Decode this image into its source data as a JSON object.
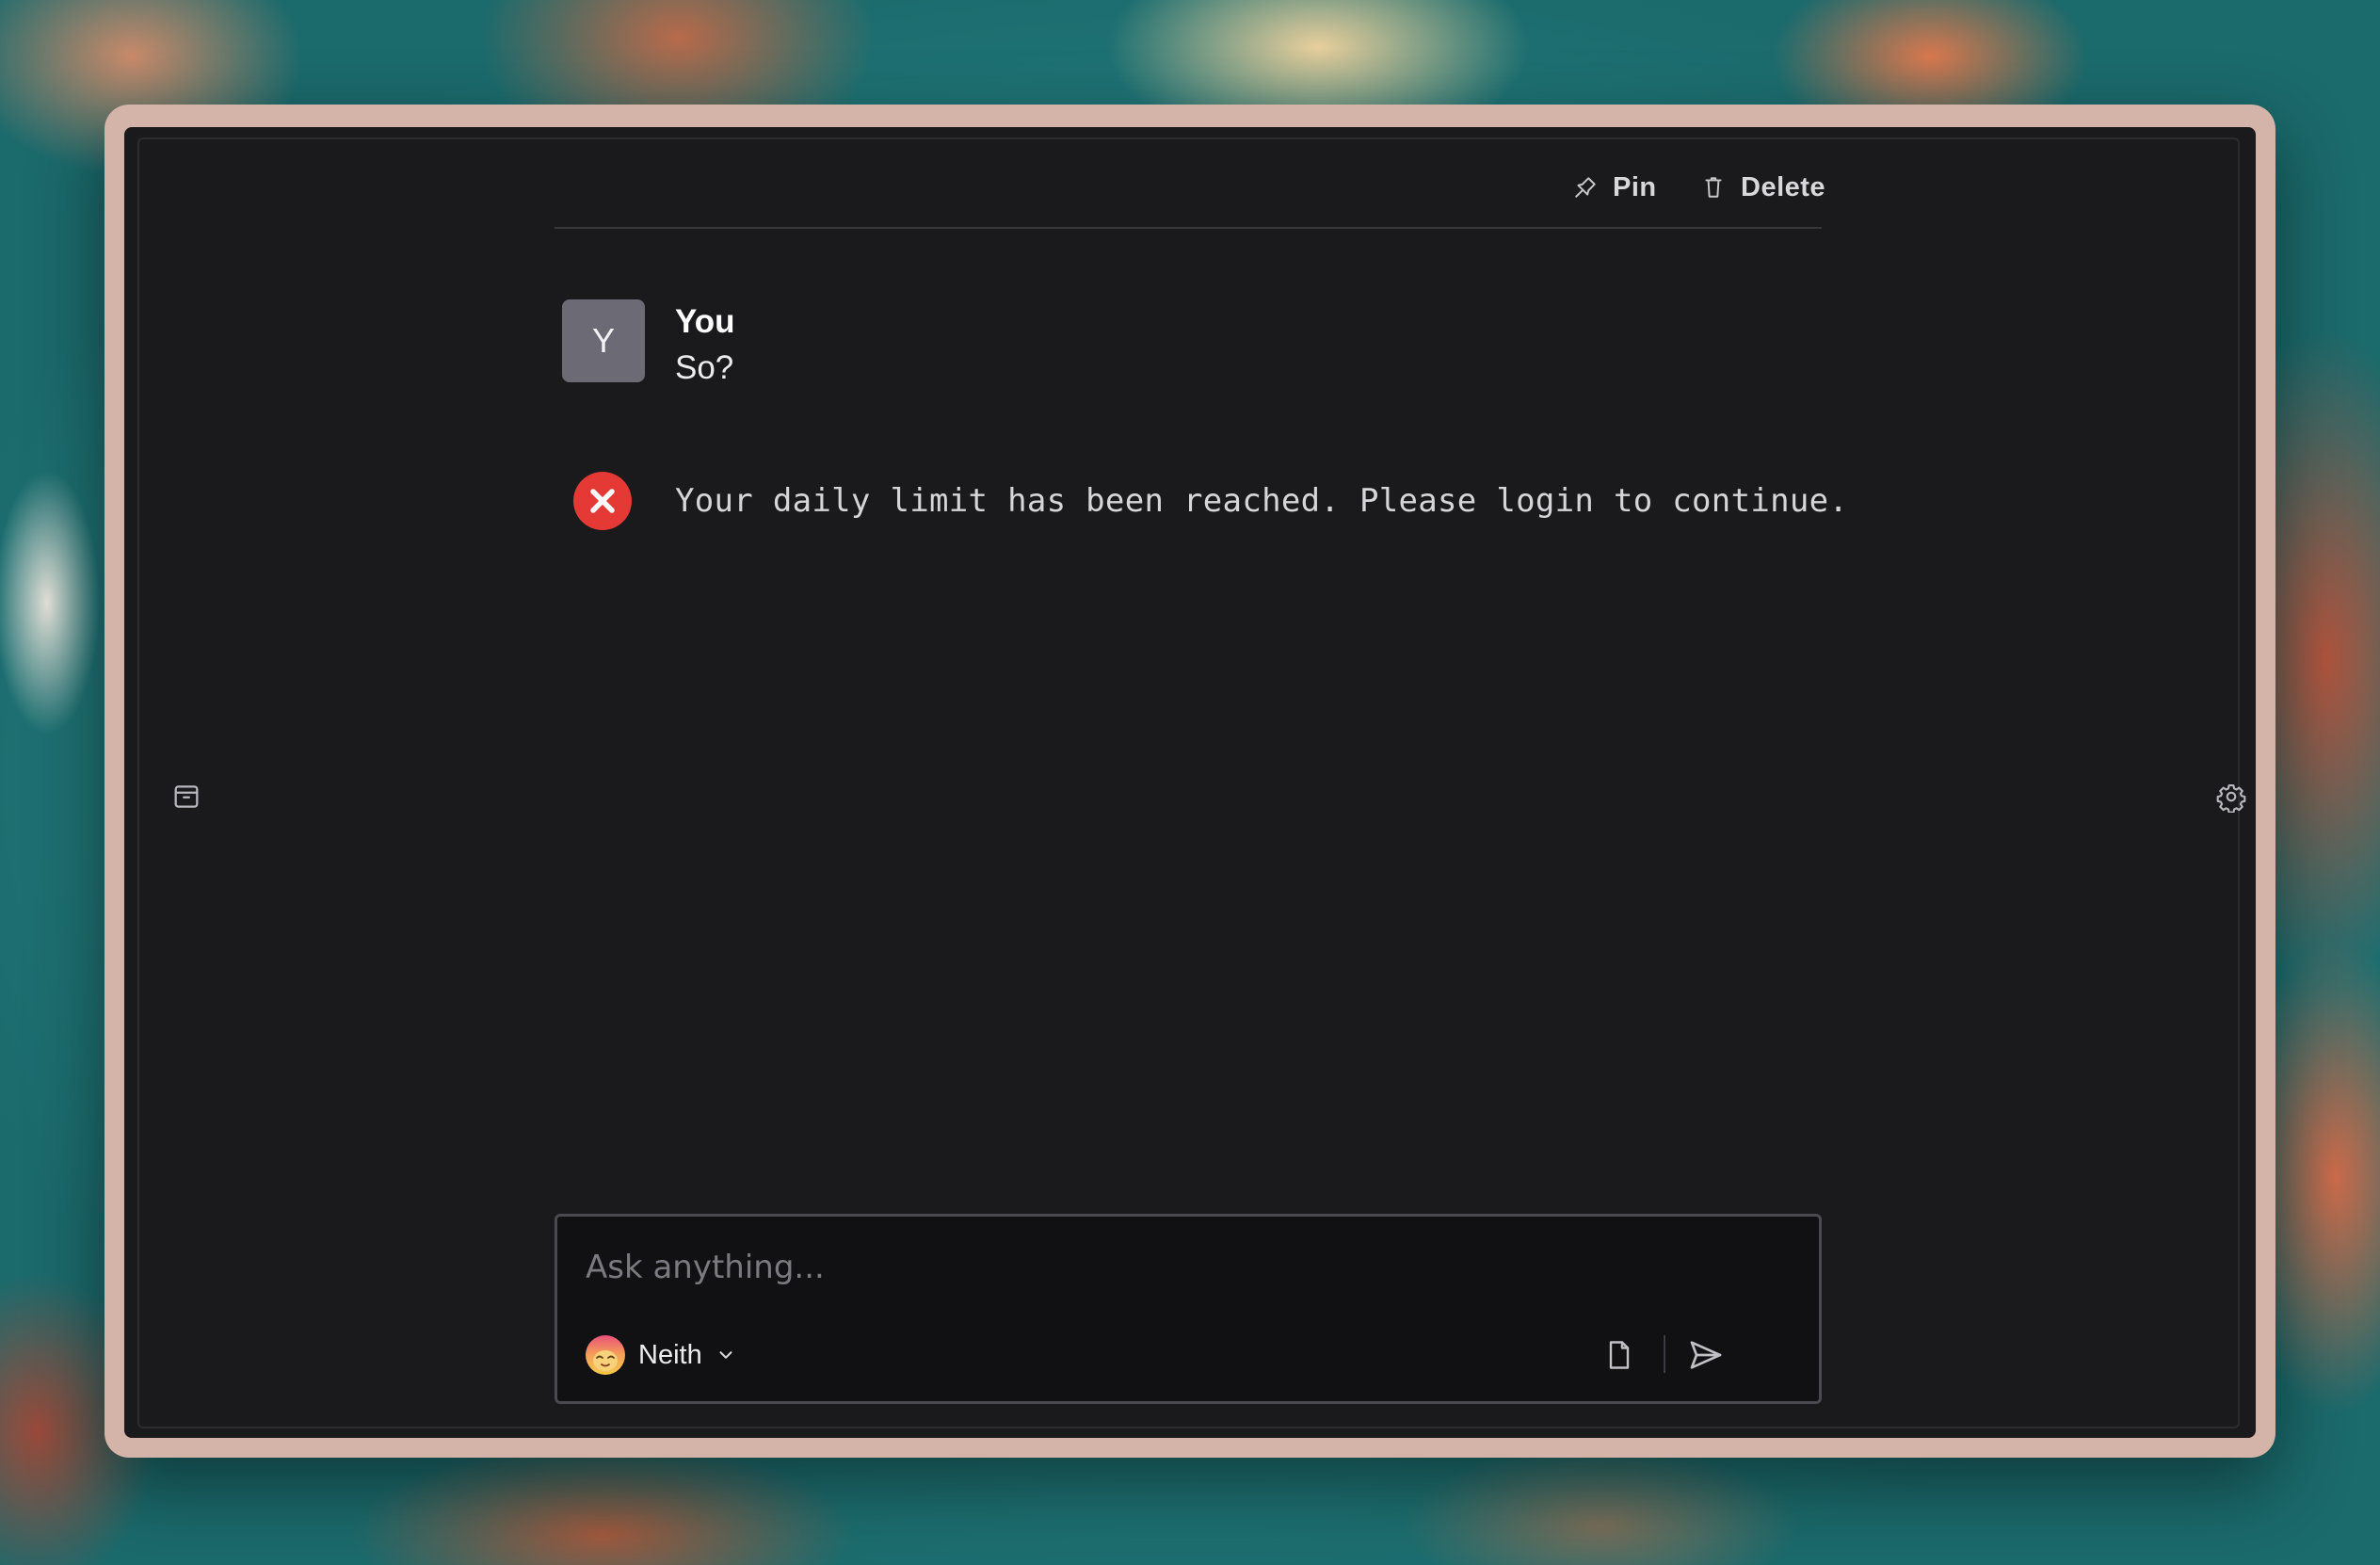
{
  "toolbar": {
    "pin_label": "Pin",
    "delete_label": "Delete"
  },
  "messages": [
    {
      "author": "You",
      "avatar_initial": "Y",
      "text": "So?"
    }
  ],
  "error": {
    "icon": "error-x-icon",
    "text": "Your daily limit has been reached. Please login to continue."
  },
  "composer": {
    "placeholder": "Ask anything...",
    "value": "",
    "model_name": "Neith"
  },
  "icons": {
    "left_sidebar": "archive-icon",
    "right_sidebar": "settings-gear-icon",
    "pin": "pin-icon",
    "delete": "trash-icon",
    "attach": "file-icon",
    "send": "send-icon",
    "model_dropdown": "chevron-down-icon"
  },
  "colors": {
    "window_frame": "#d4b3a9",
    "window_background": "#1a1a1c",
    "avatar_background": "#6c6b75",
    "error_red": "#e53935",
    "composer_background": "#111113"
  }
}
